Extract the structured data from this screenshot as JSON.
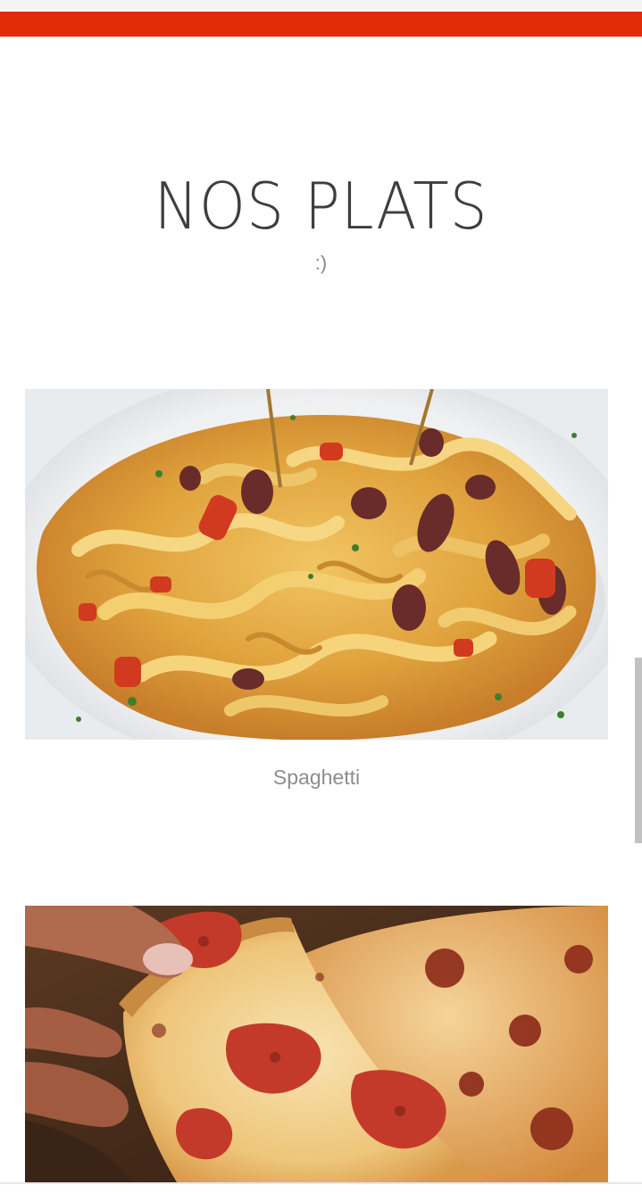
{
  "colors": {
    "accent": "#e32a09",
    "title": "#3e3e3e",
    "caption": "#8d8d8d",
    "background": "#ffffff"
  },
  "section": {
    "title": "NOS PLATS",
    "subtitle": ":)"
  },
  "dishes": [
    {
      "image": "pasta-photo",
      "name": "Spaghetti"
    },
    {
      "image": "pizza-photo",
      "name": ""
    }
  ]
}
